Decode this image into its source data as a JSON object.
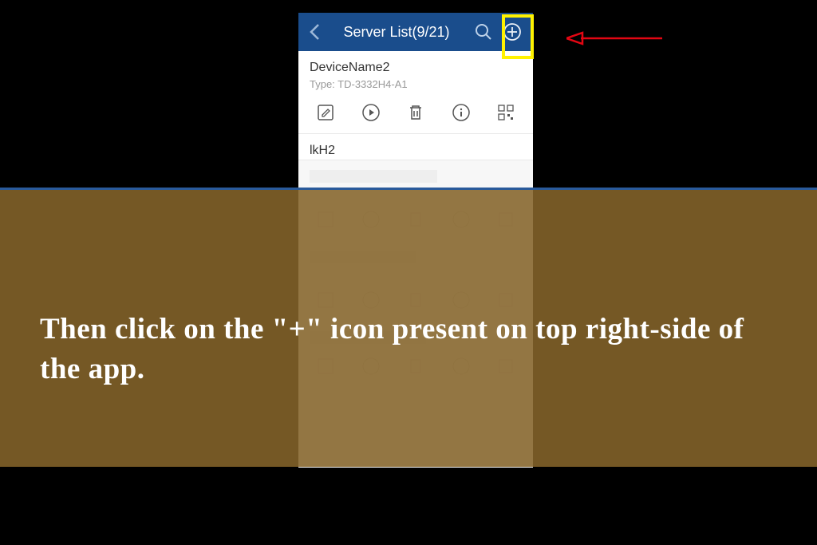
{
  "header": {
    "title": "Server List(9/21)"
  },
  "devices": [
    {
      "name": "DeviceName2",
      "type": "Type: TD-3332H4-A1"
    },
    {
      "name": "lkH2",
      "type": ""
    }
  ],
  "instruction": "Then click on the \"+\" icon present on top right-side of the app."
}
